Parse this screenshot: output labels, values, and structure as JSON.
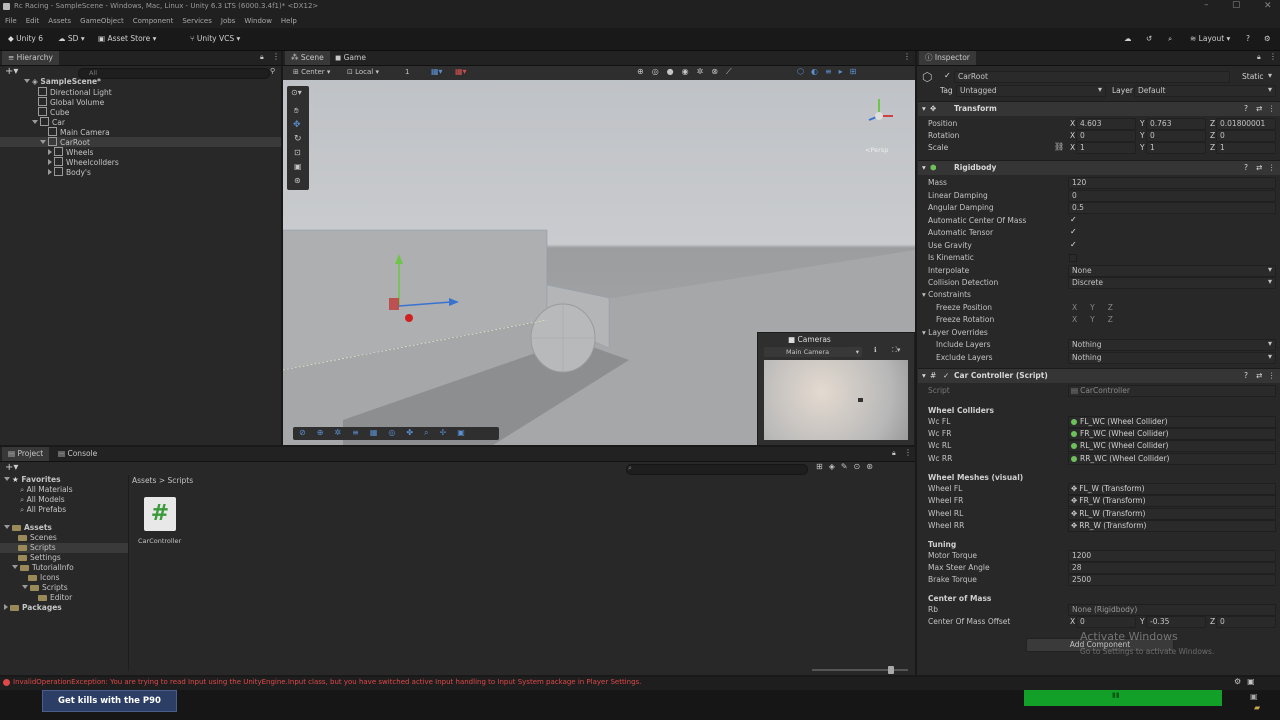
{
  "window": {
    "title": "Rc Racing - SampleScene - Windows, Mac, Linux - Unity 6.3 LTS (6000.3.4f1)* <DX12>"
  },
  "menu": [
    "File",
    "Edit",
    "Assets",
    "GameObject",
    "Component",
    "Services",
    "Jobs",
    "Window",
    "Help"
  ],
  "toolbar": {
    "account": "Unity 6",
    "sd": "SD",
    "asset_store": "Asset Store",
    "vcs": "Unity VCS",
    "layout": "Layout"
  },
  "hierarchy": {
    "tab": "Hierarchy",
    "search_placeholder": "All",
    "items": [
      {
        "label": "SampleScene*"
      },
      {
        "label": "Directional Light"
      },
      {
        "label": "Global Volume"
      },
      {
        "label": "Cube"
      },
      {
        "label": "Car"
      },
      {
        "label": "Main Camera"
      },
      {
        "label": "CarRoot"
      },
      {
        "label": "Wheels"
      },
      {
        "label": "Wheelcollders"
      },
      {
        "label": "Body's"
      }
    ]
  },
  "scene": {
    "tabs": [
      "Scene",
      "Game"
    ],
    "pivot": "Center",
    "space": "Local",
    "snap": "1",
    "persp": "<Persp",
    "cameras_overlay": {
      "title": "Cameras",
      "camera": "Main Camera"
    }
  },
  "project": {
    "tabs": [
      "Project",
      "Console"
    ],
    "favorites": {
      "label": "Favorites",
      "items": [
        "All Materials",
        "All Models",
        "All Prefabs"
      ]
    },
    "assets": {
      "label": "Assets",
      "items": [
        "Scenes",
        "Scripts",
        "Settings",
        "TutorialInfo",
        "Icons",
        "Scripts",
        "Editor"
      ]
    },
    "packages": "Packages",
    "breadcrumb": [
      "Assets",
      "Scripts"
    ],
    "file": {
      "name": "CarController",
      "glyph": "#"
    }
  },
  "inspector": {
    "tab": "Inspector",
    "object_name": "CarRoot",
    "static_label": "Static",
    "tag_label": "Tag",
    "tag": "Untagged",
    "layer_label": "Layer",
    "layer": "Default",
    "transform": {
      "title": "Transform",
      "position_label": "Position",
      "position": {
        "x": "4.603",
        "y": "0.763",
        "z": "0.01800001"
      },
      "rotation_label": "Rotation",
      "rotation": {
        "x": "0",
        "y": "0",
        "z": "0"
      },
      "scale_label": "Scale",
      "scale": {
        "x": "1",
        "y": "1",
        "z": "1"
      }
    },
    "rigidbody": {
      "title": "Rigidbody",
      "rows": [
        {
          "label": "Mass",
          "value": "120"
        },
        {
          "label": "Linear Damping",
          "value": "0"
        },
        {
          "label": "Angular Damping",
          "value": "0.5"
        },
        {
          "label": "Automatic Center Of Mass",
          "value": "✓"
        },
        {
          "label": "Automatic Tensor",
          "value": "✓"
        },
        {
          "label": "Use Gravity",
          "value": "✓"
        },
        {
          "label": "Is Kinematic",
          "value": ""
        },
        {
          "label": "Interpolate",
          "value": "None"
        },
        {
          "label": "Collision Detection",
          "value": "Discrete"
        }
      ],
      "constraints": "Constraints",
      "freeze_position": "Freeze Position",
      "freeze_rotation": "Freeze Rotation",
      "axes": [
        "X",
        "Y",
        "Z"
      ],
      "layer_overrides": "Layer Overrides",
      "include_layers": "Include Layers",
      "exclude_layers": "Exclude Layers",
      "include_value": "Nothing",
      "exclude_value": "Nothing"
    },
    "car_controller": {
      "title": "Car Controller (Script)",
      "script_label": "Script",
      "script": "CarController",
      "wheel_colliders_title": "Wheel Colliders",
      "colliders": [
        {
          "label": "Wc FL",
          "value": "FL_WC (Wheel Collider)"
        },
        {
          "label": "Wc FR",
          "value": "FR_WC (Wheel Collider)"
        },
        {
          "label": "Wc RL",
          "value": "RL_WC (Wheel Collider)"
        },
        {
          "label": "Wc RR",
          "value": "RR_WC (Wheel Collider)"
        }
      ],
      "wheel_meshes_title": "Wheel Meshes (visual)",
      "meshes": [
        {
          "label": "Wheel FL",
          "value": "FL_W (Transform)"
        },
        {
          "label": "Wheel FR",
          "value": "FR_W (Transform)"
        },
        {
          "label": "Wheel RL",
          "value": "RL_W (Transform)"
        },
        {
          "label": "Wheel RR",
          "value": "RR_W (Transform)"
        }
      ],
      "tuning_title": "Tuning",
      "tuning": [
        {
          "label": "Motor Torque",
          "value": "1200"
        },
        {
          "label": "Max Steer Angle",
          "value": "28"
        },
        {
          "label": "Brake Torque",
          "value": "2500"
        }
      ],
      "com_title": "Center of Mass",
      "rb_label": "Rb",
      "rb": "None (Rigidbody)",
      "com_offset_label": "Center Of Mass Offset",
      "com_offset": {
        "x": "0",
        "y": "-0.35",
        "z": "0"
      }
    },
    "add_component": "Add Component",
    "watermark": {
      "line1": "Activate Windows",
      "line2": "Go to Settings to activate Windows."
    }
  },
  "status": {
    "error": "InvalidOperationException: You are trying to read Input using the UnityEngine.Input class, but you have switched active Input handling to Input System package in Player Settings."
  },
  "ad": {
    "text": "Get kills with the P90"
  },
  "colors": {
    "accent": "#3a72b0",
    "error": "#e04848",
    "green_bar": "#12a028"
  }
}
